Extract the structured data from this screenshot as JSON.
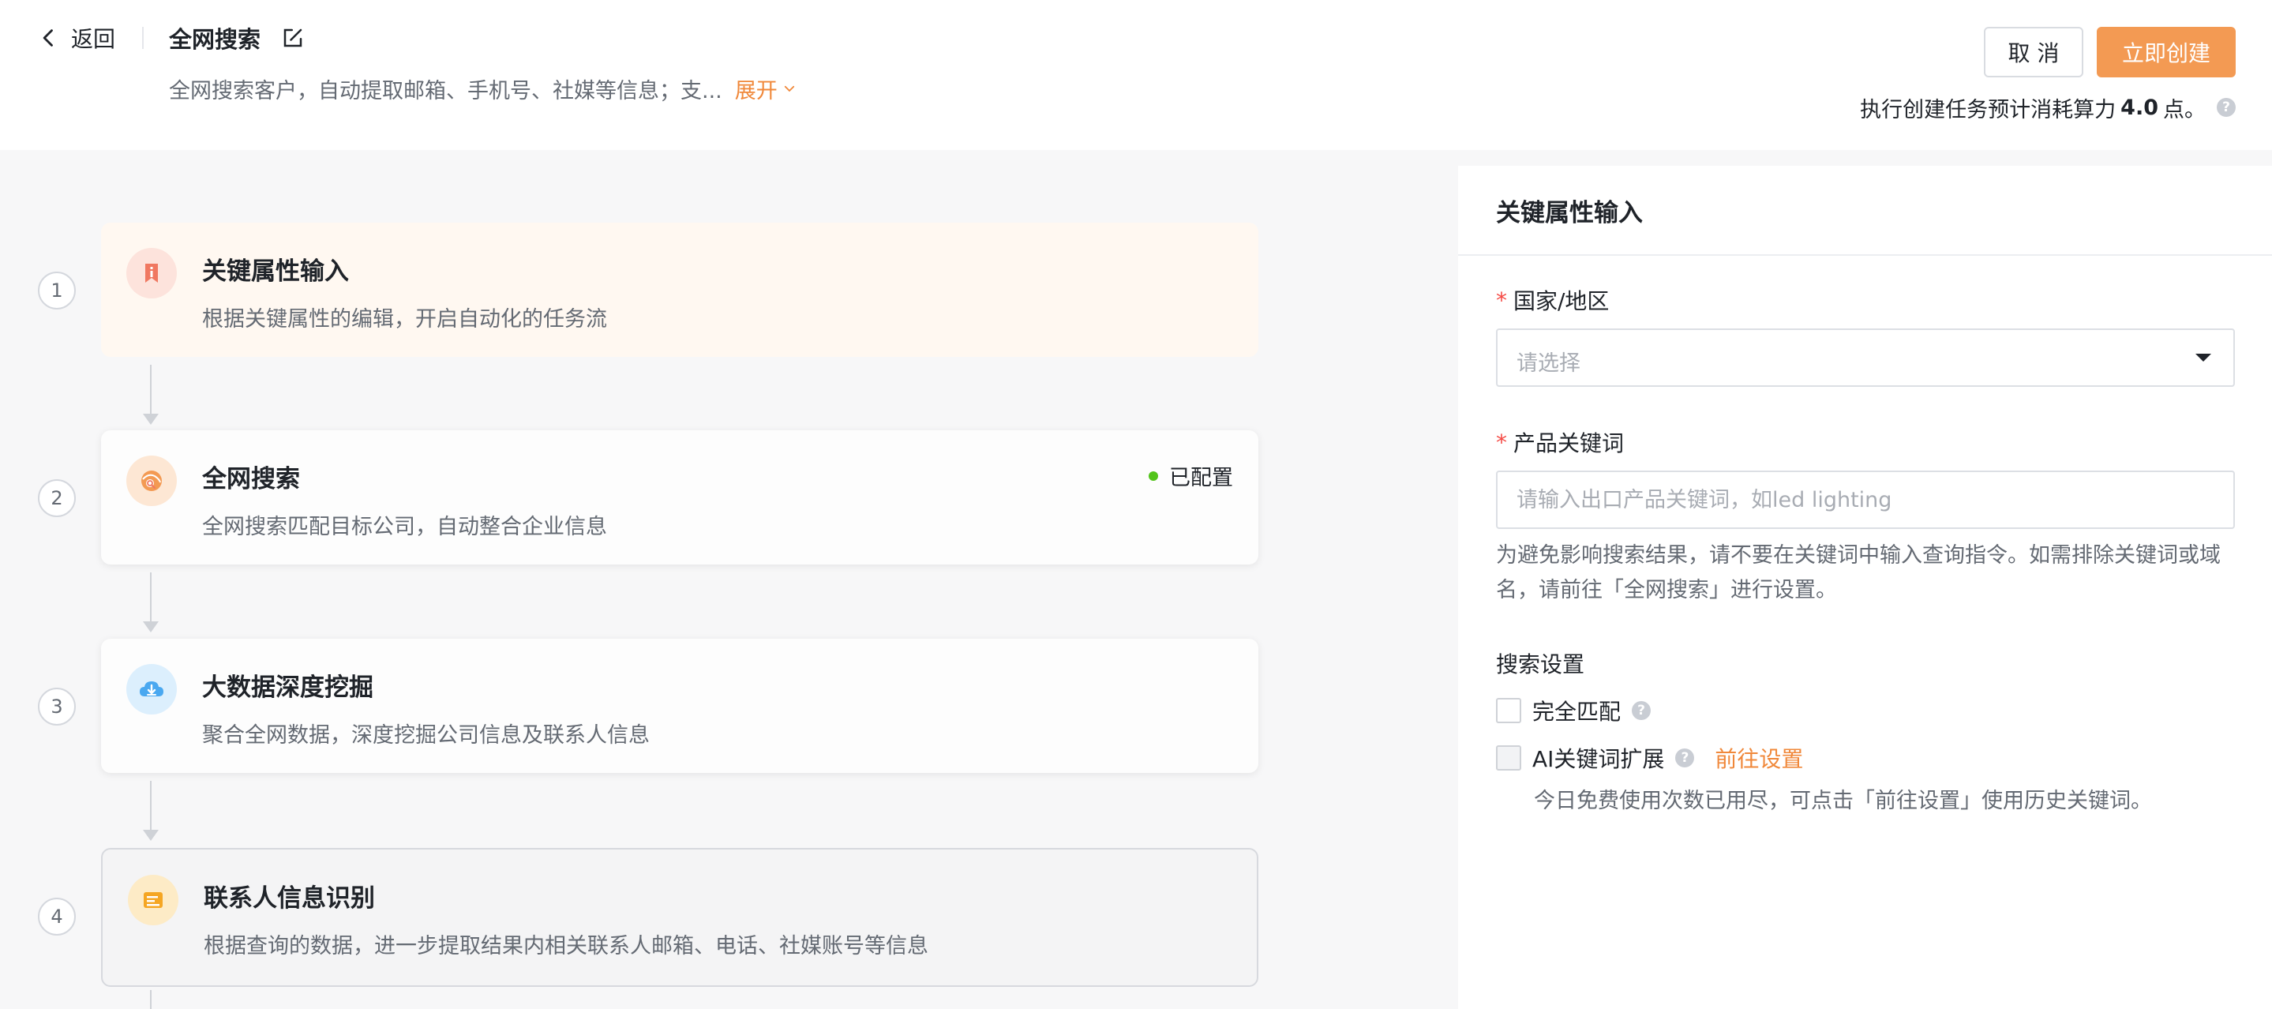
{
  "header": {
    "back_label": "返回",
    "title": "全网搜索",
    "description": "全网搜索客户，自动提取邮箱、手机号、社媒等信息；支...",
    "expand_label": "展开",
    "cancel_label": "取 消",
    "create_label": "立即创建",
    "cost_prefix": "执行创建任务预计消耗算力",
    "cost_value": "4.0",
    "cost_suffix": "点。"
  },
  "steps": [
    {
      "number": "1",
      "title": "关键属性输入",
      "desc": "根据关键属性的编辑，开启自动化的任务流",
      "status": ""
    },
    {
      "number": "2",
      "title": "全网搜索",
      "desc": "全网搜索匹配目标公司，自动整合企业信息",
      "status": "已配置"
    },
    {
      "number": "3",
      "title": "大数据深度挖掘",
      "desc": "聚合全网数据，深度挖掘公司信息及联系人信息",
      "status": ""
    },
    {
      "number": "4",
      "title": "联系人信息识别",
      "desc": "根据查询的数据，进一步提取结果内相关联系人邮箱、电话、社媒账号等信息",
      "status": ""
    }
  ],
  "panel": {
    "title": "关键属性输入",
    "country_label": "国家/地区",
    "country_placeholder": "请选择",
    "keyword_label": "产品关键词",
    "keyword_placeholder": "请输入出口产品关键词，如led lighting",
    "keyword_hint": "为避免影响搜索结果，请不要在关键词中输入查询指令。如需排除关键词或域名，请前往「全网搜索」进行设置。",
    "required_mark": "*",
    "search_settings_label": "搜索设置",
    "exact_match_label": "完全匹配",
    "ai_expand_label": "AI关键词扩展",
    "go_settings_label": "前往设置",
    "ai_note": "今日免费使用次数已用尽，可点击「前往设置」使用历史关键词。"
  },
  "colors": {
    "accent": "#f39a53",
    "accent_text": "#f0883a",
    "status_green": "#52c41a",
    "required_red": "#f54a45"
  }
}
